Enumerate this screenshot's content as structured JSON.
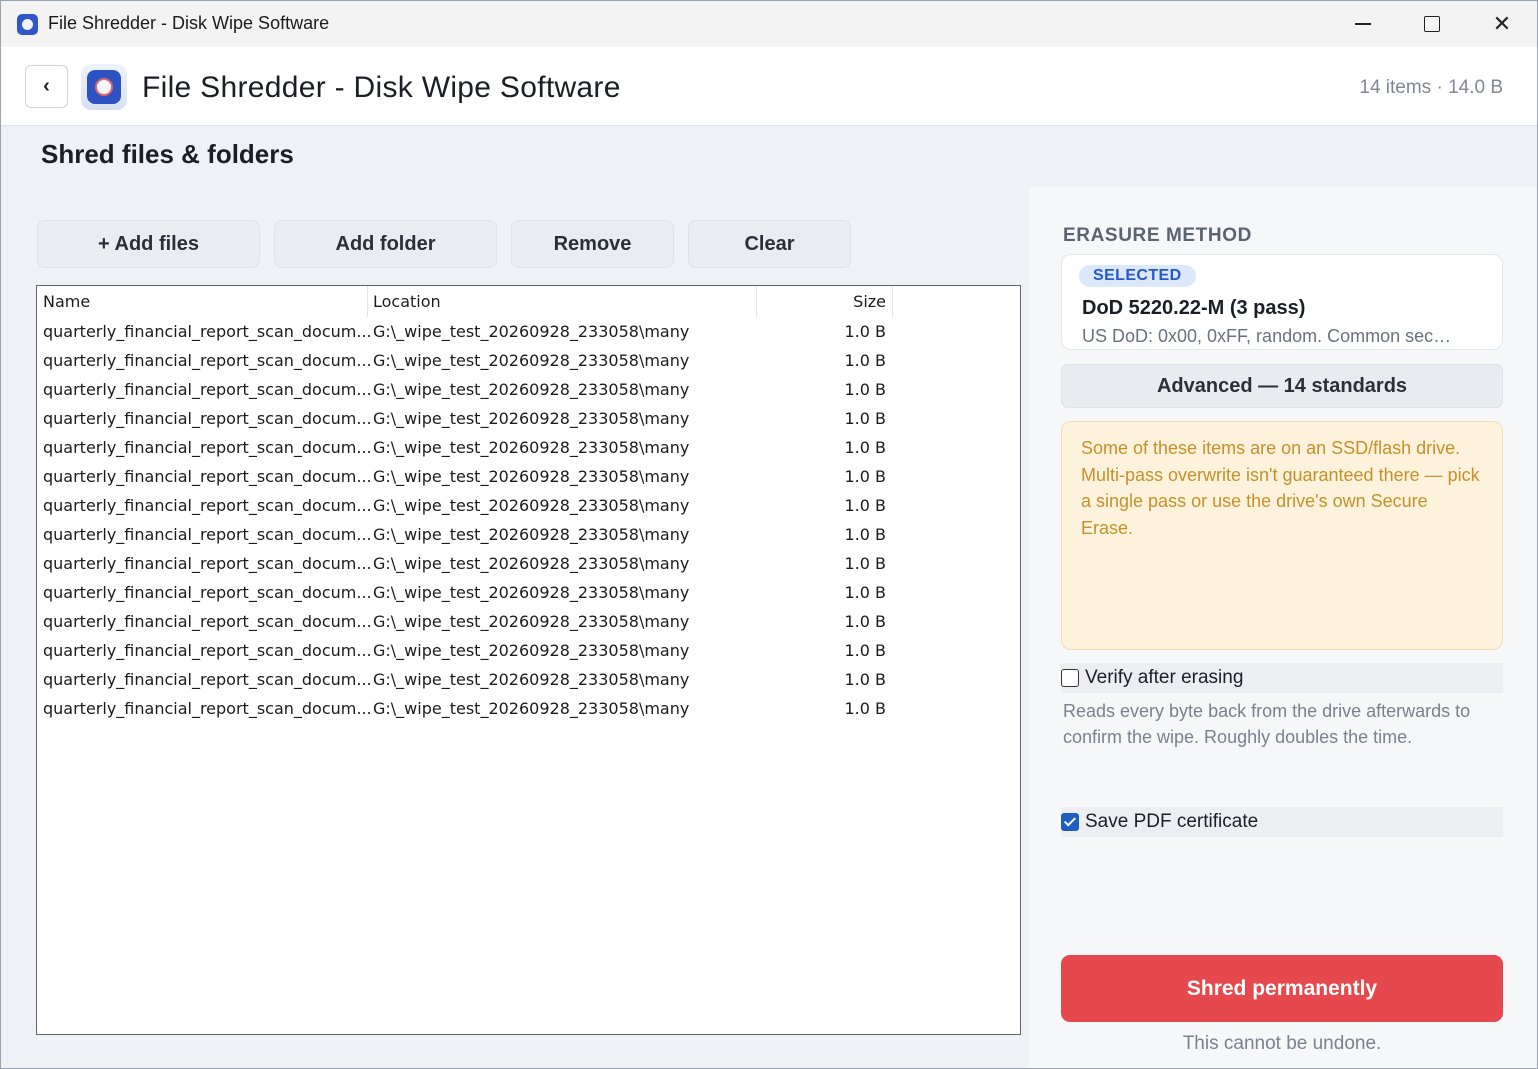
{
  "window": {
    "title": "File Shredder - Disk Wipe Software",
    "min_icon": "minimize-icon",
    "max_icon": "maximize-icon",
    "close_icon": "close-icon",
    "close_glyph": "✕"
  },
  "header": {
    "back_glyph": "‹",
    "title": "File Shredder - Disk Wipe Software",
    "meta": "14 items · 14.0 B"
  },
  "section_title": "Shred files & folders",
  "toolbar": {
    "add_files": "+ Add files",
    "add_folder": "Add folder",
    "remove": "Remove",
    "clear": "Clear"
  },
  "file_list": {
    "columns": [
      "Name",
      "Location",
      "Size"
    ],
    "rows": [
      {
        "name": "quarterly_financial_report_scan_docum...",
        "location": "G:\\_wipe_test_20260928_233058\\many",
        "size": "1.0 B"
      },
      {
        "name": "quarterly_financial_report_scan_docum...",
        "location": "G:\\_wipe_test_20260928_233058\\many",
        "size": "1.0 B"
      },
      {
        "name": "quarterly_financial_report_scan_docum...",
        "location": "G:\\_wipe_test_20260928_233058\\many",
        "size": "1.0 B"
      },
      {
        "name": "quarterly_financial_report_scan_docum...",
        "location": "G:\\_wipe_test_20260928_233058\\many",
        "size": "1.0 B"
      },
      {
        "name": "quarterly_financial_report_scan_docum...",
        "location": "G:\\_wipe_test_20260928_233058\\many",
        "size": "1.0 B"
      },
      {
        "name": "quarterly_financial_report_scan_docum...",
        "location": "G:\\_wipe_test_20260928_233058\\many",
        "size": "1.0 B"
      },
      {
        "name": "quarterly_financial_report_scan_docum...",
        "location": "G:\\_wipe_test_20260928_233058\\many",
        "size": "1.0 B"
      },
      {
        "name": "quarterly_financial_report_scan_docum...",
        "location": "G:\\_wipe_test_20260928_233058\\many",
        "size": "1.0 B"
      },
      {
        "name": "quarterly_financial_report_scan_docum...",
        "location": "G:\\_wipe_test_20260928_233058\\many",
        "size": "1.0 B"
      },
      {
        "name": "quarterly_financial_report_scan_docum...",
        "location": "G:\\_wipe_test_20260928_233058\\many",
        "size": "1.0 B"
      },
      {
        "name": "quarterly_financial_report_scan_docum...",
        "location": "G:\\_wipe_test_20260928_233058\\many",
        "size": "1.0 B"
      },
      {
        "name": "quarterly_financial_report_scan_docum...",
        "location": "G:\\_wipe_test_20260928_233058\\many",
        "size": "1.0 B"
      },
      {
        "name": "quarterly_financial_report_scan_docum...",
        "location": "G:\\_wipe_test_20260928_233058\\many",
        "size": "1.0 B"
      },
      {
        "name": "quarterly_financial_report_scan_docum...",
        "location": "G:\\_wipe_test_20260928_233058\\many",
        "size": "1.0 B"
      }
    ]
  },
  "erasure": {
    "label": "ERASURE METHOD",
    "badge": "SELECTED",
    "method_name": "DoD 5220.22-M (3 pass)",
    "method_desc": "US DoD: 0x00, 0xFF, random. Common sec…",
    "advanced": "Advanced — 14 standards",
    "warning": "Some of these items are on an SSD/flash drive. Multi-pass overwrite isn't guaranteed there — pick a single pass or use the drive's own Secure Erase.",
    "verify_label": "Verify after erasing",
    "verify_checked": false,
    "verify_desc": "Reads every byte back from the drive afterwards to confirm the wipe. Roughly doubles the time.",
    "pdf_label": "Save PDF certificate",
    "pdf_checked": true,
    "shred_button": "Shred permanently",
    "undo_note": "This cannot be undone."
  },
  "colors": {
    "accent": "#1d5fc1",
    "danger": "#e5484d",
    "warning_bg": "#fdf3dc",
    "warning_text": "#c58f2a"
  }
}
